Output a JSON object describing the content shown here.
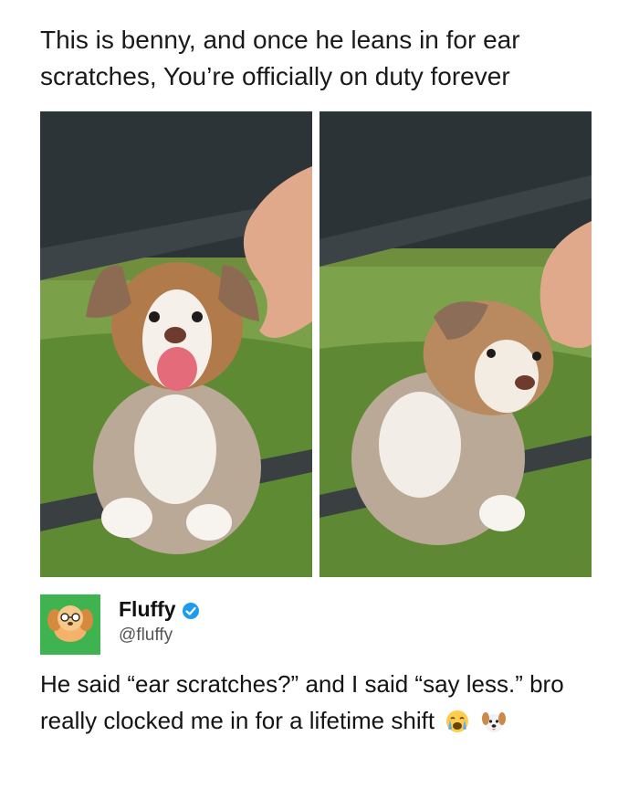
{
  "caption": "This is benny, and once he leans in for ear scratches, You’re officially on duty forever",
  "photos": [
    {
      "icon": "puppy-photo-open-mouth"
    },
    {
      "icon": "puppy-photo-ear-scratch"
    }
  ],
  "post": {
    "avatar_icon": "dog-avatar-icon",
    "author_name": "Fluffy",
    "verified_icon": "verified-badge-icon",
    "author_handle": "@fluffy",
    "text": "He said “ear scratches?” and I said “say less.” bro really clocked me in for a lifetime shift",
    "emojis": [
      "crying-face-icon",
      "dog-face-icon"
    ]
  },
  "colors": {
    "avatar_bg": "#3fb34f",
    "verified": "#1d9bf0",
    "handle": "#555555"
  }
}
